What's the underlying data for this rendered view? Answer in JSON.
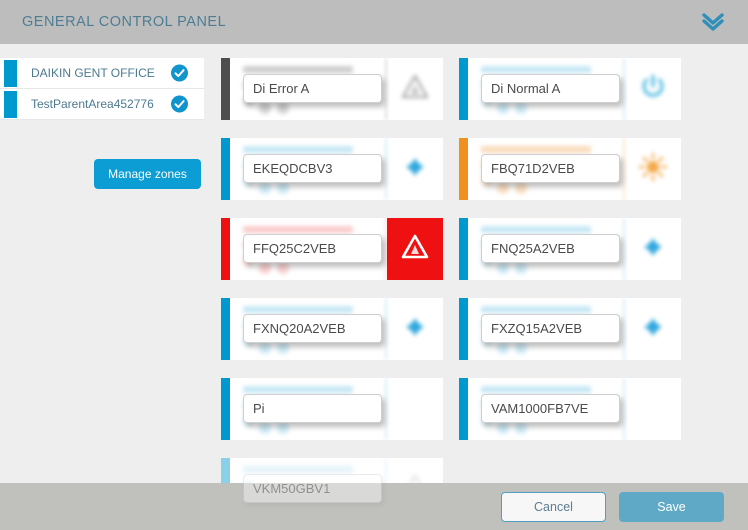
{
  "header": {
    "title": "GENERAL CONTROL PANEL",
    "collapse_icon": "chevron-double-down-icon"
  },
  "colors": {
    "accent_blue": "#0099cf",
    "button_blue": "#0b9dd3",
    "save_blue": "#5fa9c6",
    "error_red": "#ef1111",
    "warning_orange": "#f0901e",
    "offline_gray": "#4d4d4d",
    "header_gray": "#bdbdbd",
    "footer_gray": "#c0c0bd",
    "page_bg": "#eeeeee"
  },
  "sidebar": {
    "zones": [
      {
        "label": "DAIKIN GENT OFFICE",
        "check_icon": "check-circle-icon",
        "selected": true
      },
      {
        "label": "TestParentArea452776",
        "check_icon": "check-circle-icon",
        "selected": true
      }
    ],
    "manage_zones_label": "Manage zones"
  },
  "cards": [
    {
      "name": "Di Error A",
      "bar_color": "#4d4d4d",
      "icon": "warning-triangle-icon",
      "icon_color": "#b0b0b0",
      "icon_style": "plain",
      "faded": false
    },
    {
      "name": "Di Normal A",
      "bar_color": "#0099cf",
      "icon": "power-icon",
      "icon_color": "#4eb9e0",
      "icon_style": "plain",
      "faded": false
    },
    {
      "name": "EKEQDCBV3",
      "bar_color": "#0099cf",
      "icon": "fan-diamond-icon",
      "icon_color": "#2fa7dd",
      "icon_style": "plain",
      "faded": false
    },
    {
      "name": "FBQ71D2VEB",
      "bar_color": "#f0901e",
      "icon": "heat-mode-icon",
      "icon_color": "#f4a94a",
      "icon_style": "plain",
      "faded": false
    },
    {
      "name": "FFQ25C2VEB",
      "bar_color": "#ef1111",
      "icon": "warning-triangle-icon",
      "icon_color": "#ffffff",
      "icon_style": "filled",
      "faded": false
    },
    {
      "name": "FNQ25A2VEB",
      "bar_color": "#0099cf",
      "icon": "fan-diamond-icon",
      "icon_color": "#2fa7dd",
      "icon_style": "plain",
      "faded": false
    },
    {
      "name": "FXNQ20A2VEB",
      "bar_color": "#0099cf",
      "icon": "fan-diamond-icon",
      "icon_color": "#2fa7dd",
      "icon_style": "plain",
      "faded": false
    },
    {
      "name": "FXZQ15A2VEB",
      "bar_color": "#0099cf",
      "icon": "fan-diamond-icon",
      "icon_color": "#2fa7dd",
      "icon_style": "plain",
      "faded": false
    },
    {
      "name": "Pi",
      "bar_color": "#0099cf",
      "icon": "none",
      "icon_color": "#2fa7dd",
      "icon_style": "plain",
      "faded": false
    },
    {
      "name": "VAM1000FB7VE",
      "bar_color": "#0099cf",
      "icon": "none",
      "icon_color": "#2fa7dd",
      "icon_style": "plain",
      "faded": false
    },
    {
      "name": "VKM50GBV1",
      "bar_color": "#0099cf",
      "icon": "warning-triangle-icon",
      "icon_color": "#c8c8c8",
      "icon_style": "plain",
      "faded": true
    }
  ],
  "footer": {
    "cancel_label": "Cancel",
    "save_label": "Save"
  }
}
